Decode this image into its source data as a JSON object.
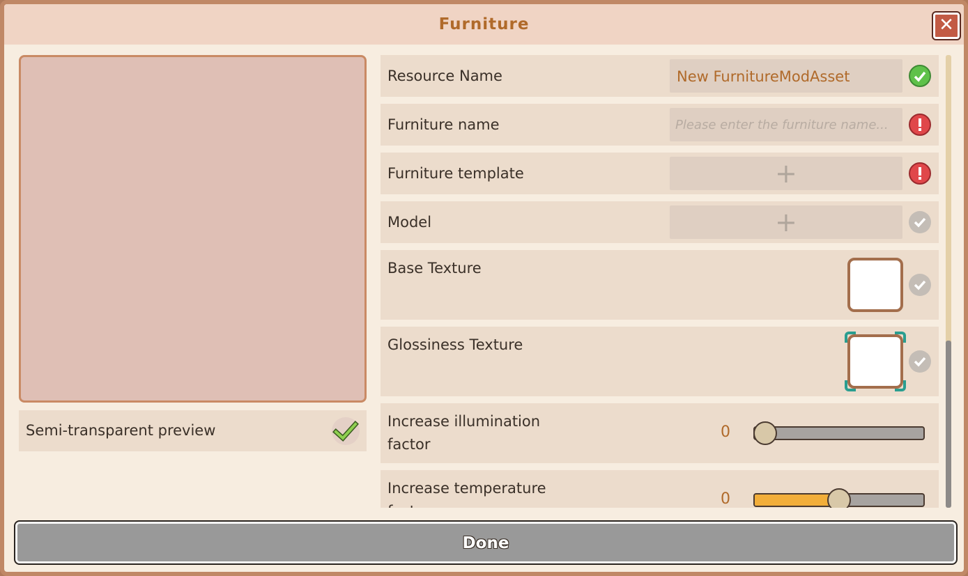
{
  "window": {
    "title": "Furniture",
    "close_icon": "close-icon"
  },
  "preview": {
    "semi_transparent_label": "Semi-transparent preview",
    "semi_transparent_checked": true
  },
  "properties": {
    "resource_name": {
      "label": "Resource Name",
      "value": "New FurnitureModAsset",
      "status": "ok"
    },
    "furniture_name": {
      "label": "Furniture name",
      "placeholder": "Please enter the furniture name...",
      "status": "error"
    },
    "furniture_template": {
      "label": "Furniture template",
      "status": "error"
    },
    "model": {
      "label": "Model",
      "status": "neutral"
    },
    "base_texture": {
      "label": "Base Texture",
      "status": "neutral"
    },
    "glossiness_texture": {
      "label": "Glossiness Texture",
      "status": "neutral"
    },
    "illumination": {
      "label_line1": "Increase illumination",
      "label_line2": "factor",
      "value": "0",
      "fill_fraction": 0.0
    },
    "temperature": {
      "label_line1": "Increase temperature",
      "label_line2": "factor",
      "value": "0",
      "fill_fraction": 0.5
    }
  },
  "footer": {
    "done_label": "Done"
  },
  "colors": {
    "accent_text": "#b06a2a",
    "ok": "#5fc14a",
    "error": "#e0474a",
    "slider_fill": "#f2ae3a"
  }
}
